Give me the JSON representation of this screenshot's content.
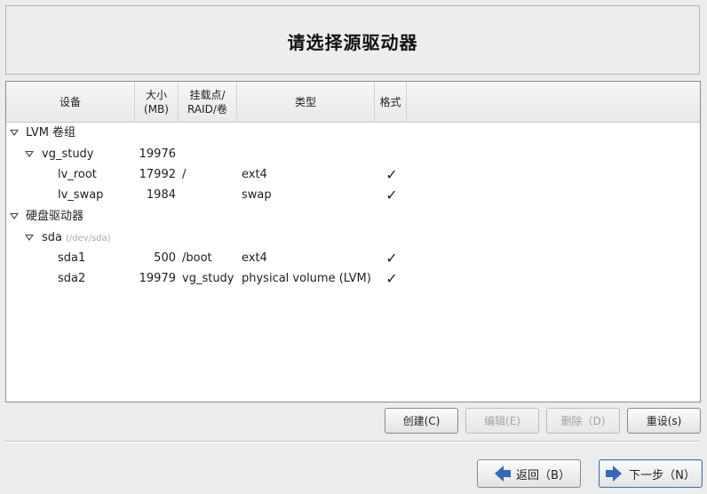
{
  "title": "请选择源驱动器",
  "columns": {
    "device": "设备",
    "size_line1": "大小",
    "size_line2": "(MB)",
    "mount_line1": "挂载点/",
    "mount_line2": "RAID/卷",
    "type": "类型",
    "format": "格式"
  },
  "tree": {
    "lvm_group": {
      "label": "LVM 卷组"
    },
    "vg_study": {
      "label": "vg_study",
      "size": "19976"
    },
    "lv_root": {
      "label": "lv_root",
      "size": "17992",
      "mount": "/",
      "type": "ext4",
      "format": "✓"
    },
    "lv_swap": {
      "label": "lv_swap",
      "size": "1984",
      "mount": "",
      "type": "swap",
      "format": "✓"
    },
    "hard_drives": {
      "label": "硬盘驱动器"
    },
    "sda": {
      "label": "sda",
      "path": "(/dev/sda)"
    },
    "sda1": {
      "label": "sda1",
      "size": "500",
      "mount": "/boot",
      "type": "ext4",
      "format": "✓"
    },
    "sda2": {
      "label": "sda2",
      "size": "19979",
      "mount": "vg_study",
      "type": "physical volume (LVM)",
      "format": "✓"
    }
  },
  "buttons": {
    "create": "创建(C)",
    "edit": "编辑(E)",
    "delete": "删除（D)",
    "reset": "重设(s)",
    "back": "返回（B）",
    "next": "下一步（N）"
  },
  "icons": {
    "back": "arrow-left-icon",
    "next": "arrow-right-icon",
    "expander": "triangle-down-icon",
    "format_check": "checkmark-icon"
  },
  "colors": {
    "arrow": "#3569b5",
    "panel_border": "#8c8c8c",
    "background": "#ececec"
  }
}
